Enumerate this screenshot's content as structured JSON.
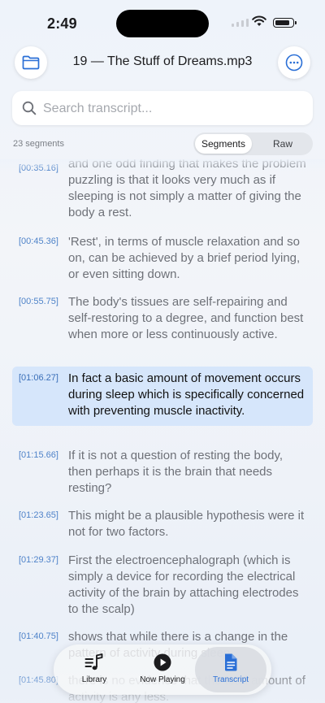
{
  "status": {
    "time": "2:49"
  },
  "header": {
    "title": "19 — The Stuff of Dreams.mp3"
  },
  "search": {
    "placeholder": "Search transcript..."
  },
  "controls": {
    "segment_count": "23 segments",
    "modes": [
      "Segments",
      "Raw"
    ],
    "selected_mode": "Segments"
  },
  "transcript": {
    "segments": [
      {
        "time": "[00:35.16]",
        "text": "and one odd finding that makes the problem puzzling is that it looks very much as if sleeping is not simply a matter of giving the body a rest."
      },
      {
        "time": "[00:45.36]",
        "text": "'Rest', in terms of muscle relaxation and so on, can be achieved by a brief period lying, or even sitting down."
      },
      {
        "time": "[00:55.75]",
        "text": "The body's tissues are self-repairing and self-restoring to a degree, and function best when more or less continuously active."
      },
      {
        "time": "[01:06.27]",
        "text": "In fact a basic amount of movement occurs during sleep which is specifically concerned with preventing muscle inactivity.",
        "active": true
      },
      {
        "time": "[01:15.66]",
        "text": "If it is not a question of resting the body, then perhaps it is the brain that needs resting?"
      },
      {
        "time": "[01:23.65]",
        "text": "This might be a plausible hypothesis were it not for two factors."
      },
      {
        "time": "[01:29.37]",
        "text": "First the electroencephalograph (which is simply a device for recording the electrical activity of the brain by attaching electrodes to the scalp)"
      },
      {
        "time": "[01:40.75]",
        "text": "shows that while there is a change in the pattern of activity during sleep,"
      },
      {
        "time": "[01:45.80]",
        "text": "there is no evidence that the total amount of activity is any less."
      }
    ]
  },
  "tabbar": {
    "tabs": [
      {
        "label": "Library",
        "icon": "music-note-list-icon"
      },
      {
        "label": "Now Playing",
        "icon": "play-circle-icon"
      },
      {
        "label": "Transcript",
        "icon": "document-icon",
        "selected": true
      }
    ]
  },
  "colors": {
    "accent": "#2a6fd6",
    "timestamp": "#4f83c9",
    "active_row": "#d6e6fb"
  }
}
